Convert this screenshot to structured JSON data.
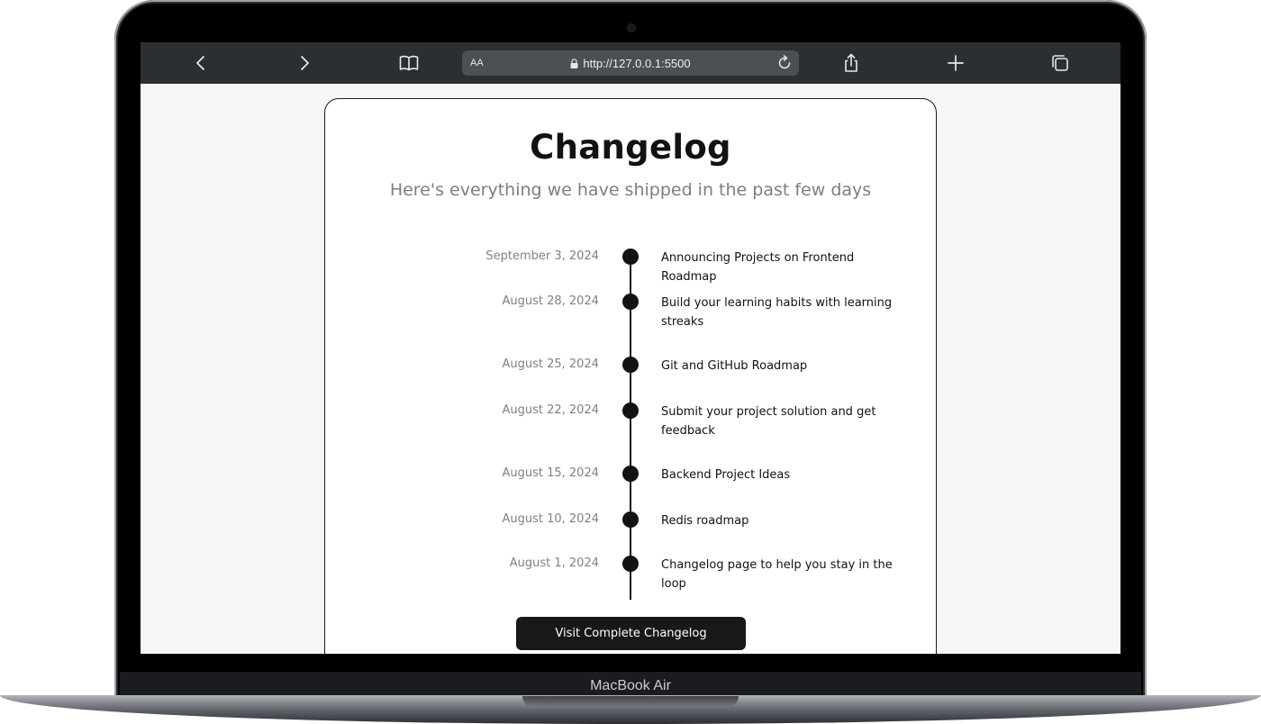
{
  "device": {
    "label": "MacBook Air"
  },
  "browser": {
    "text_size_label": "AA",
    "url": "http://127.0.0.1:5500",
    "icons": [
      "chevron-left-icon",
      "chevron-right-icon",
      "book-icon",
      "lock-icon",
      "reload-icon",
      "share-icon",
      "plus-icon",
      "tabs-icon"
    ]
  },
  "page": {
    "title": "Changelog",
    "subtitle": "Here's everything we have shipped in the past few days",
    "entries": [
      {
        "date": "September 3, 2024",
        "title": "Announcing Projects on Frontend Roadmap"
      },
      {
        "date": "August 28, 2024",
        "title": "Build your learning habits with learning streaks"
      },
      {
        "date": "August 25, 2024",
        "title": "Git and GitHub Roadmap"
      },
      {
        "date": "August 22, 2024",
        "title": "Submit your project solution and get feedback"
      },
      {
        "date": "August 15, 2024",
        "title": "Backend Project Ideas"
      },
      {
        "date": "August 10, 2024",
        "title": "Redis roadmap"
      },
      {
        "date": "August 1, 2024",
        "title": "Changelog page to help you stay in the loop"
      }
    ],
    "cta_label": "Visit Complete Changelog"
  },
  "colors": {
    "toolbar_bg": "#2b2f32",
    "urlbar_bg": "#4c4f53",
    "page_bg": "#f6f6f6",
    "card_bg": "#ffffff",
    "text_dark": "#121212",
    "text_muted": "#7a7f86",
    "button_bg": "#17181a"
  }
}
